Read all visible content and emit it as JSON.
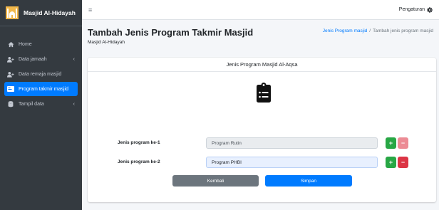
{
  "sidebar": {
    "brand": "Masjid Al-Hidayah",
    "items": [
      {
        "label": "Home",
        "icon": "home-icon"
      },
      {
        "label": "Data jamaah",
        "icon": "user-plus-icon",
        "chevron": "‹"
      },
      {
        "label": "Data remaja masjid",
        "icon": "user-plus-icon"
      },
      {
        "label": "Program takmir masjid",
        "icon": "id-card-icon"
      },
      {
        "label": "Tampil data",
        "icon": "database-icon",
        "chevron": "‹"
      }
    ]
  },
  "navbar": {
    "menu_icon": "≡",
    "settings_label": "Pengaturan"
  },
  "header": {
    "title": "Tambah Jenis Program Takmir Masjid",
    "subtitle": "Masjid Al-Hidayah"
  },
  "breadcrumb": {
    "link": "Jenis Program masjid",
    "separator": "/",
    "current": "Tambah jenis program masjid"
  },
  "card": {
    "title": "Jenis Program Masjid Al-Aqsa",
    "rows": [
      {
        "label": "Jenis program ke-1",
        "value": "Program Rutin"
      },
      {
        "label": "Jenis program ke-2",
        "value": "Program PHBI"
      }
    ],
    "plus_label": "+",
    "minus_label": "−",
    "back_label": "Kembali",
    "save_label": "Simpan"
  },
  "colors": {
    "sidebar_bg": "#343a40",
    "accent": "#007bff",
    "success": "#28a745",
    "danger": "#dc3545",
    "secondary": "#6c757d"
  }
}
